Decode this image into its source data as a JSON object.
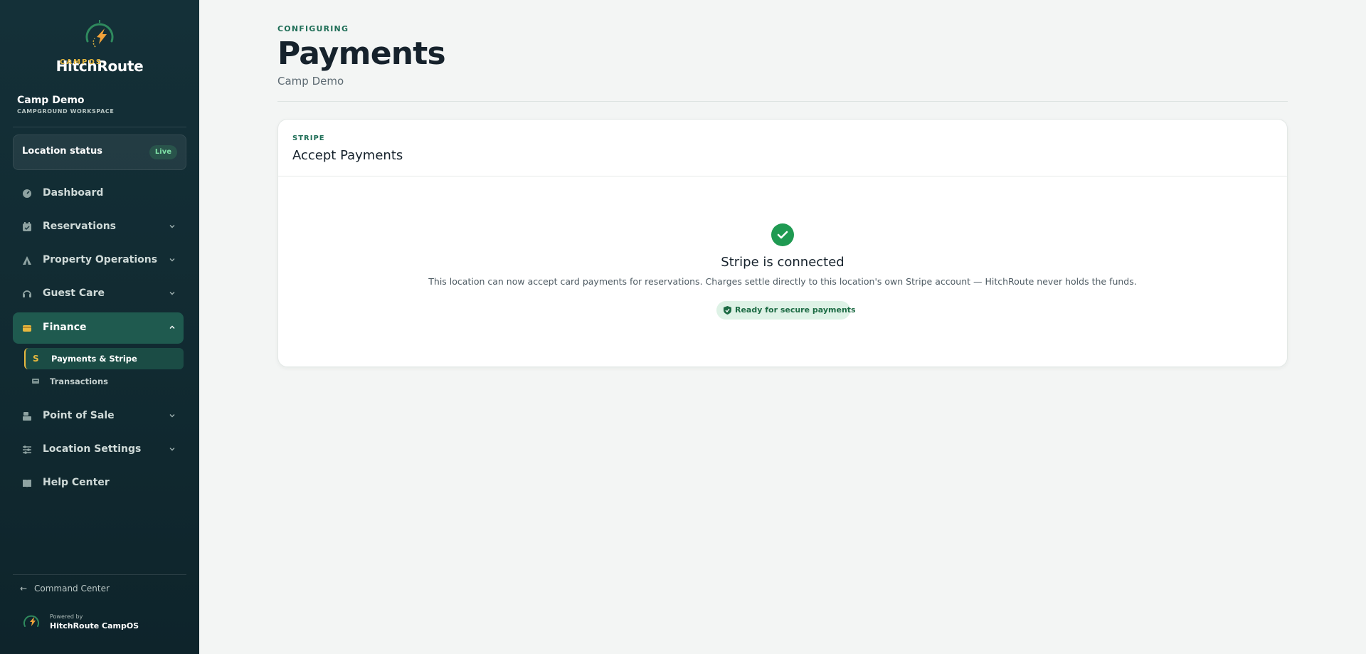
{
  "brand": {
    "name": "HitchRoute",
    "sub": "CAMPOS"
  },
  "workspace": {
    "name": "Camp Demo",
    "sub": "CAMPGROUND WORKSPACE"
  },
  "status": {
    "label": "Location status",
    "badge": "Live"
  },
  "nav": [
    {
      "label": "Dashboard",
      "icon": "gauge-icon"
    },
    {
      "label": "Reservations",
      "icon": "calendar-icon"
    },
    {
      "label": "Property Operations",
      "icon": "tent-icon"
    },
    {
      "label": "Guest Care",
      "icon": "headset-icon"
    },
    {
      "label": "Finance",
      "icon": "wallet-icon",
      "active": true
    },
    {
      "label": "Point of Sale",
      "icon": "register-icon"
    },
    {
      "label": "Location Settings",
      "icon": "sliders-icon"
    },
    {
      "label": "Help Center",
      "icon": "book-icon"
    }
  ],
  "finance_sub": [
    {
      "label": "Payments & Stripe",
      "icon": "stripe-s-icon",
      "glyph": "S",
      "active": true
    },
    {
      "label": "Transactions",
      "icon": "receipt-icon"
    }
  ],
  "command_center": "Command Center",
  "powered": {
    "small": "Powered by",
    "big": "HitchRoute CampOS"
  },
  "page": {
    "eyebrow": "CONFIGURING",
    "title": "Payments",
    "sub": "Camp Demo"
  },
  "card": {
    "eyebrow": "STRIPE",
    "title": "Accept Payments",
    "connected_title": "Stripe is connected",
    "connected_desc": "This location can now accept card payments for reservations. Charges settle directly to this location's own Stripe account — HitchRoute never holds the funds.",
    "badge": "Ready for secure payments"
  },
  "colors": {
    "sidebar": "#143038",
    "accent": "#1f6e57",
    "gold": "#e7b83f",
    "success": "#1f9a52"
  }
}
